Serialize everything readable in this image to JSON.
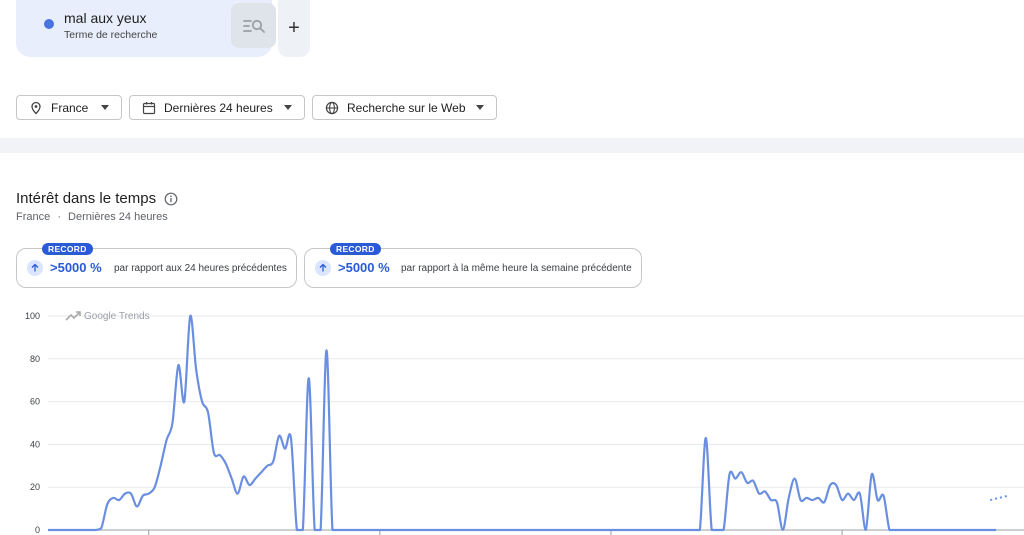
{
  "search_term": {
    "name": "mal aux yeux",
    "type_label": "Terme de recherche",
    "color": "#4a73e2"
  },
  "add_button": {
    "label": "+"
  },
  "filters": {
    "region": "France",
    "period": "Dernières 24 heures",
    "search_type": "Recherche sur le Web"
  },
  "section": {
    "title": "Intérêt dans le temps",
    "region": "France",
    "separator": "·",
    "period": "Dernières 24 heures"
  },
  "stats": [
    {
      "badge": "RECORD",
      "value": ">5000 %",
      "description": "par rapport aux 24 heures précédentes"
    },
    {
      "badge": "RECORD",
      "value": ">5000 %",
      "description": "par rapport à la même heure la semaine précédente"
    }
  ],
  "chart_data": {
    "type": "line",
    "watermark": "Google Trends",
    "ylim": [
      0,
      100
    ],
    "yticks": [
      "100",
      "80",
      "60",
      "40",
      "20",
      "0"
    ],
    "grid": true,
    "x": [
      0,
      1,
      2,
      3,
      4,
      5,
      6,
      7,
      8,
      9,
      10,
      11,
      12,
      13,
      14,
      15,
      16,
      17,
      18,
      19,
      20,
      21,
      22,
      23,
      24,
      25,
      26,
      27,
      28,
      29,
      30,
      31,
      32,
      33,
      34,
      35,
      36,
      37,
      38,
      39,
      40,
      41,
      42,
      43,
      44,
      45,
      46,
      47,
      48,
      49,
      50,
      51,
      52,
      53,
      54,
      55,
      56,
      57,
      58,
      59,
      60,
      61,
      62,
      63,
      64,
      65,
      66,
      67,
      68,
      69,
      70,
      71,
      72,
      73,
      74,
      75,
      76,
      77,
      78,
      79,
      80,
      81,
      82,
      83,
      84,
      85,
      86,
      87,
      88,
      89,
      90,
      91,
      92,
      93,
      94,
      95,
      96,
      97,
      98,
      99,
      100,
      101,
      102,
      103,
      104,
      105,
      106,
      107,
      108,
      109,
      110,
      111,
      112,
      113,
      114,
      115,
      116,
      117,
      118,
      119,
      120,
      121,
      122,
      123,
      124,
      125,
      126,
      127,
      128,
      129,
      130,
      131,
      132,
      133,
      134,
      135,
      136,
      137,
      138,
      139,
      140,
      141,
      142,
      143,
      144,
      145,
      146,
      147,
      148,
      149,
      150,
      151,
      152,
      153,
      154,
      155,
      156,
      157,
      158,
      159,
      160
    ],
    "series": [
      {
        "color": "#6b8fe0",
        "values": [
          0,
          0,
          0,
          0,
          0,
          0,
          0,
          0,
          0,
          1,
          12,
          15,
          14,
          17,
          17,
          11,
          16,
          17,
          20,
          30,
          42,
          50,
          77,
          60,
          100,
          75,
          60,
          55,
          36,
          35,
          31,
          24,
          17,
          25,
          21,
          24,
          27,
          30,
          32,
          44,
          38,
          43,
          0,
          0,
          71,
          0,
          0,
          84,
          0,
          0,
          0,
          0,
          0,
          0,
          0,
          0,
          0,
          0,
          0,
          0,
          0,
          0,
          0,
          0,
          0,
          0,
          0,
          0,
          0,
          0,
          0,
          0,
          0,
          0,
          0,
          0,
          0,
          0,
          0,
          0,
          0,
          0,
          0,
          0,
          0,
          0,
          0,
          0,
          0,
          0,
          0,
          0,
          0,
          0,
          0,
          0,
          0,
          0,
          0,
          0,
          0,
          0,
          0,
          0,
          0,
          0,
          0,
          0,
          0,
          0,
          0,
          43,
          0,
          0,
          0,
          26,
          24,
          27,
          22,
          23,
          17,
          18,
          14,
          13,
          0,
          15,
          24,
          14,
          15,
          14,
          15,
          13,
          21,
          21,
          14,
          17,
          14,
          17,
          0,
          26,
          14,
          16,
          0,
          0,
          0,
          0,
          0,
          0,
          0,
          0,
          0,
          0,
          0,
          0,
          0,
          0,
          0,
          0,
          0,
          0,
          0
        ]
      }
    ],
    "partial_tail": [
      14,
      16
    ]
  }
}
